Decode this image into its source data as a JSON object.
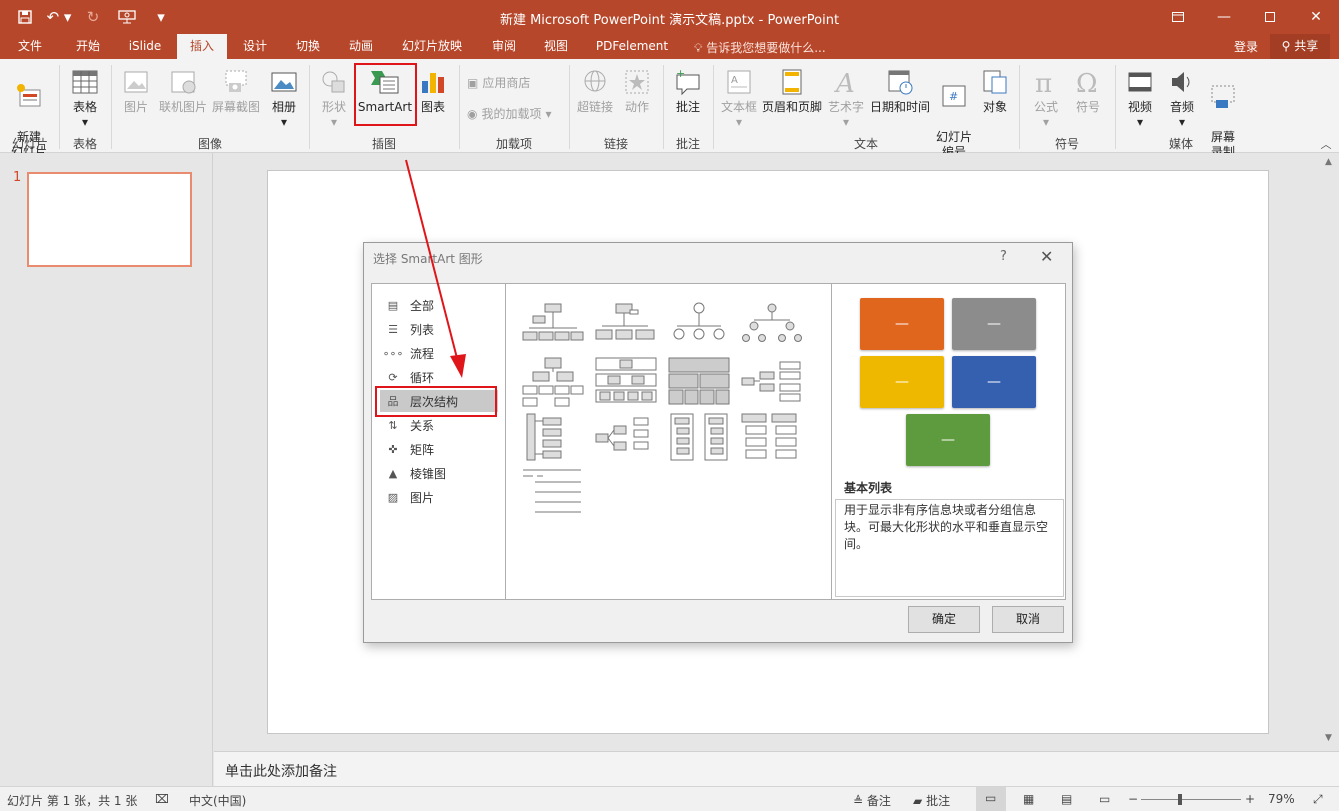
{
  "window": {
    "title": "新建 Microsoft PowerPoint 演示文稿.pptx - PowerPoint"
  },
  "tabs": [
    {
      "label": "文件"
    },
    {
      "label": "开始"
    },
    {
      "label": "iSlide"
    },
    {
      "label": "插入"
    },
    {
      "label": "设计"
    },
    {
      "label": "切换"
    },
    {
      "label": "动画"
    },
    {
      "label": "幻灯片放映"
    },
    {
      "label": "审阅"
    },
    {
      "label": "视图"
    },
    {
      "label": "PDFelement"
    }
  ],
  "tellme": "告诉我您想要做什么...",
  "login": "登录",
  "share": "共享",
  "ribbon": {
    "new_slide": "新建\n幻灯片",
    "table": "表格",
    "picture": "图片",
    "online_picture": "联机图片",
    "screenshot": "屏幕截图",
    "album": "相册",
    "shapes": "形状",
    "smartart": "SmartArt",
    "chart": "图表",
    "store": "应用商店",
    "my_addins": "我的加载项",
    "hyperlink": "超链接",
    "action": "动作",
    "comment": "批注",
    "textbox": "文本框",
    "header_footer": "页眉和页脚",
    "wordart": "艺术字",
    "datetime": "日期和时间",
    "slide_number": "幻灯片\n编号",
    "object": "对象",
    "equation": "公式",
    "symbol": "符号",
    "video": "视频",
    "audio": "音频",
    "screen_record": "屏幕\n录制",
    "groups": {
      "slides": "幻灯片",
      "tables": "表格",
      "images": "图像",
      "illustrations": "插图",
      "addins": "加载项",
      "links": "链接",
      "comments": "批注",
      "text": "文本",
      "symbols": "符号",
      "media": "媒体"
    }
  },
  "thumbs": {
    "number": "1"
  },
  "notes": "单击此处添加备注",
  "status": {
    "slide_info": "幻灯片 第 1 张，共 1 张",
    "language": "中文(中国)",
    "notes": "备注",
    "comments": "批注",
    "zoom": "79%"
  },
  "dialog": {
    "title": "选择 SmartArt 图形",
    "help": "?",
    "categories": [
      {
        "label": "全部"
      },
      {
        "label": "列表"
      },
      {
        "label": "流程"
      },
      {
        "label": "循环"
      },
      {
        "label": "层次结构"
      },
      {
        "label": "关系"
      },
      {
        "label": "矩阵"
      },
      {
        "label": "棱锥图"
      },
      {
        "label": "图片"
      }
    ],
    "preview_title": "基本列表",
    "preview_desc": "用于显示非有序信息块或者分组信息块。可最大化形状的水平和垂直显示空间。",
    "preview_colors": [
      "#e0661e",
      "#8c8c8c",
      "#efb800",
      "#3560b0",
      "#5e9a3e"
    ],
    "ok": "确定",
    "cancel": "取消"
  }
}
